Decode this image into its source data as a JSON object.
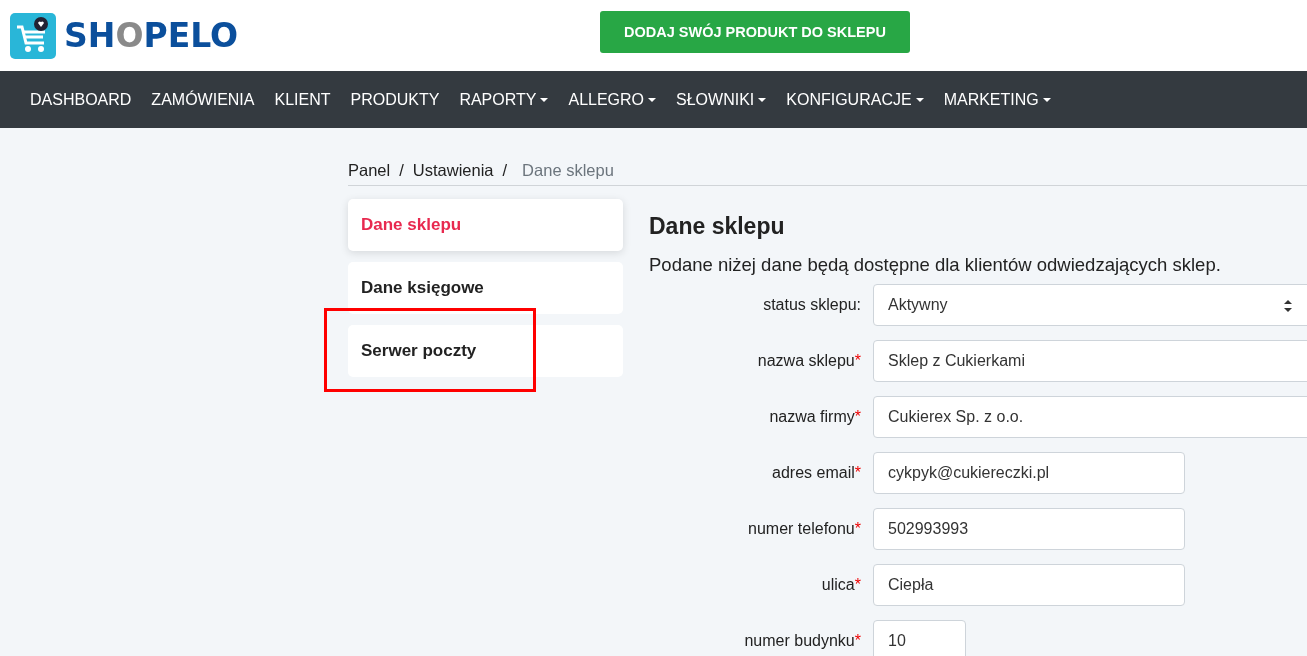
{
  "header": {
    "logo": [
      {
        "text": "SH",
        "color": "#0b4f9c"
      },
      {
        "text": "O",
        "color": "#8a8a8a"
      },
      {
        "text": "PELO",
        "color": "#0b4f9c"
      }
    ],
    "cta_button": "DODAJ SWÓJ PRODUKT DO SKLEPU"
  },
  "nav": [
    {
      "label": "DASHBOARD",
      "dropdown": false
    },
    {
      "label": "ZAMÓWIENIA",
      "dropdown": false
    },
    {
      "label": "KLIENT",
      "dropdown": false
    },
    {
      "label": "PRODUKTY",
      "dropdown": false
    },
    {
      "label": "RAPORTY",
      "dropdown": true
    },
    {
      "label": "ALLEGRO",
      "dropdown": true
    },
    {
      "label": "SŁOWNIKI",
      "dropdown": true
    },
    {
      "label": "KONFIGURACJE",
      "dropdown": true
    },
    {
      "label": "MARKETING",
      "dropdown": true
    }
  ],
  "breadcrumb": [
    {
      "label": "Panel",
      "current": false
    },
    {
      "label": "Ustawienia",
      "current": false
    },
    {
      "label": "Dane sklepu",
      "current": true
    }
  ],
  "breadcrumb_separator": "/",
  "sidebar": {
    "items": [
      {
        "label": "Dane sklepu",
        "selected": true,
        "highlighted": false
      },
      {
        "label": "Dane księgowe",
        "selected": false,
        "highlighted": false
      },
      {
        "label": "Serwer poczty",
        "selected": false,
        "highlighted": true
      }
    ]
  },
  "main": {
    "title": "Dane sklepu",
    "subtitle": "Podane niżej dane będą dostępne dla klientów odwiedzających sklep.",
    "fields": [
      {
        "kind": "select",
        "label": "status sklepu:",
        "value": "Aktywny"
      },
      {
        "kind": "wide",
        "label": "nazwa sklepu",
        "required_mark": "*",
        "value": "Sklep z Cukierkami"
      },
      {
        "kind": "wide",
        "label": "nazwa firmy",
        "required_mark": "*",
        "value": "Cukierex Sp. z o.o."
      },
      {
        "kind": "medium",
        "label": "adres email",
        "required_mark": "*",
        "value": "cykpyk@cukiereczki.pl"
      },
      {
        "kind": "medium",
        "label": "numer telefonu",
        "required_mark": "*",
        "value": "502993993"
      },
      {
        "kind": "medium",
        "label": "ulica",
        "required_mark": "*",
        "value": "Ciepła"
      },
      {
        "kind": "short",
        "label": "numer budynku",
        "required_mark": "*",
        "value": "10"
      }
    ]
  }
}
